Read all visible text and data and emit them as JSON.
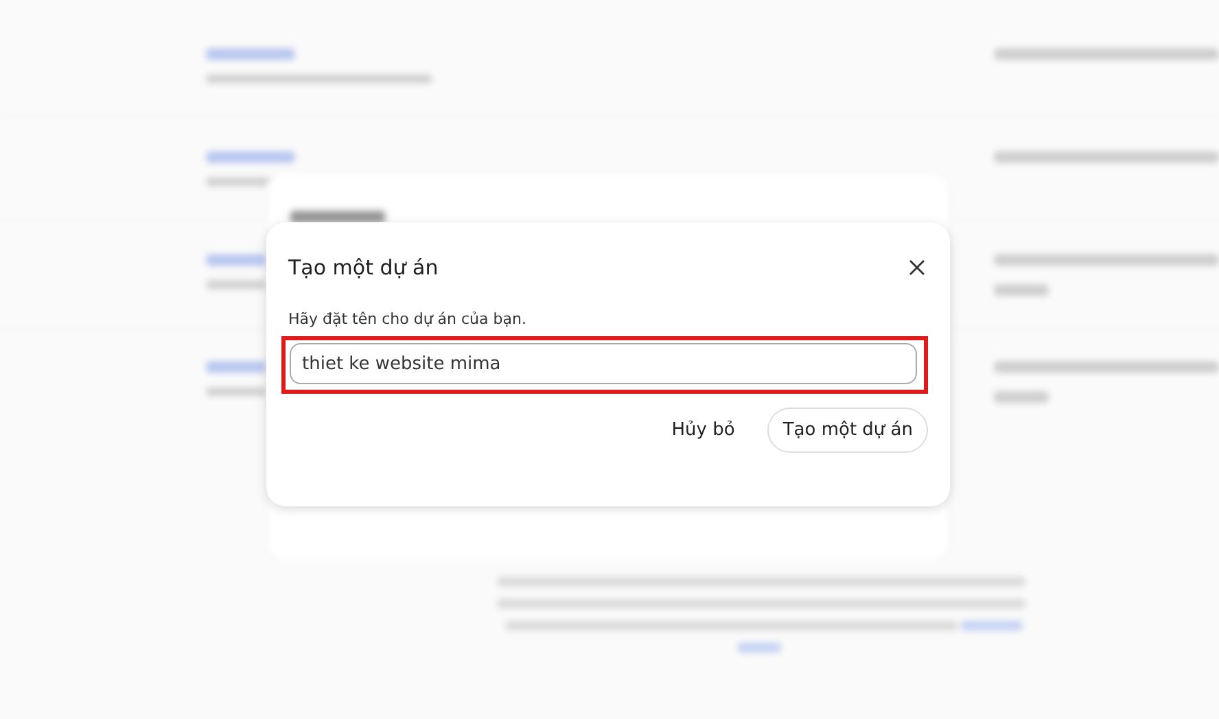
{
  "dialog": {
    "title": "Tạo một dự án",
    "label": "Hãy đặt tên cho dự án của bạn.",
    "input": {
      "value": "thiet ke website mima",
      "highlighted": true
    },
    "buttons": [
      {
        "label": "Hủy bỏ",
        "kind": "text"
      },
      {
        "label": "Tạo một dự án",
        "kind": "outlined"
      }
    ]
  }
}
